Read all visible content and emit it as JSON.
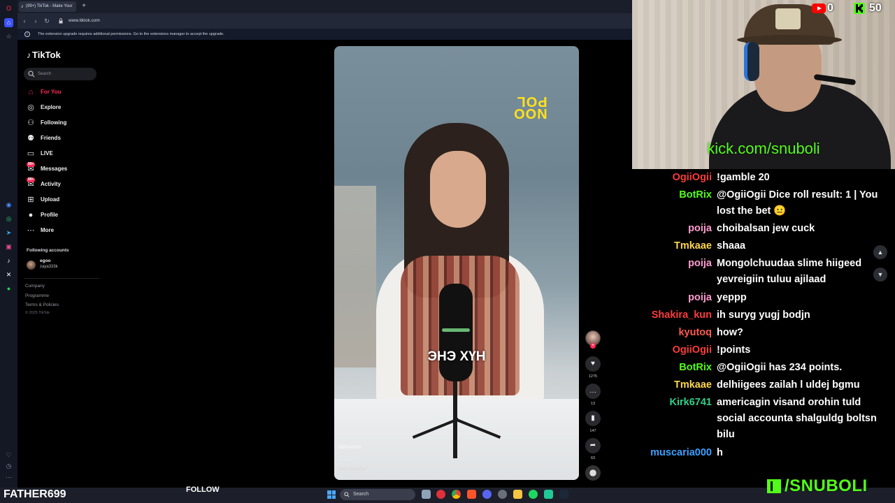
{
  "browser": {
    "tab_title": "(99+) TikTok - Make Your",
    "url": "www.tiktok.com",
    "notice": "The extension upgrade requires additional permissions. Go to the extensions manager to accept the upgrade."
  },
  "tiktok": {
    "logo": "TikTok",
    "search_placeholder": "Search",
    "nav": [
      {
        "label": "For You",
        "icon": "home-icon",
        "active": true
      },
      {
        "label": "Explore",
        "icon": "compass-icon"
      },
      {
        "label": "Following",
        "icon": "following-icon"
      },
      {
        "label": "Friends",
        "icon": "friends-icon"
      },
      {
        "label": "LIVE",
        "icon": "live-icon"
      },
      {
        "label": "Messages",
        "icon": "messages-icon",
        "badge": "99+"
      },
      {
        "label": "Activity",
        "icon": "activity-icon",
        "badge": "99+"
      },
      {
        "label": "Upload",
        "icon": "upload-icon"
      },
      {
        "label": "Profile",
        "icon": "profile-icon"
      },
      {
        "label": "More",
        "icon": "more-icon"
      }
    ],
    "following_accounts_title": "Following accounts",
    "account": {
      "name": "egoo",
      "handle": "zaya333k"
    },
    "footer": [
      "Company",
      "Programme",
      "Terms & Policies"
    ],
    "copyright": "© 2025 TikTok"
  },
  "video": {
    "brand": "NOO\nPOL",
    "caption": "ЭНЭ ХҮН",
    "author": "dahuvan0",
    "description": "Б.Ринчен",
    "see_translation": "See translation",
    "likes": "1275",
    "comments": "13",
    "saves": "147",
    "shares": "63"
  },
  "stream": {
    "youtube_count": "0",
    "kick_count": "50",
    "kick_url": "kick.com/snuboli",
    "streamer_name": "FATHER699",
    "follow_label": "FOLLOW",
    "kick_handle": "/SNUBOLI",
    "colors": {
      "kick_green": "#53fc18",
      "youtube_red": "#ff0000"
    }
  },
  "chat": [
    {
      "user": "OgiiOgii",
      "color": "#ff3b3b",
      "text": "!gamble 20"
    },
    {
      "user": "BotRix",
      "color": "#53fc18",
      "text": "@OgiiOgii Dice roll result: 1 | You lost the bet 😐"
    },
    {
      "user": "poija",
      "color": "#ff9cd0",
      "text": "choibalsan jew cuck"
    },
    {
      "user": "Tmkaae",
      "color": "#ffd84a",
      "text": "shaaa"
    },
    {
      "user": "poija",
      "color": "#ff9cd0",
      "text": "Mongolchuudaa slime hiigeed yevreigiin tuluu ajilaad"
    },
    {
      "user": "poija",
      "color": "#ff9cd0",
      "text": "yeppp"
    },
    {
      "user": "Shakira_kun",
      "color": "#ff3b3b",
      "text": "ih suryg yugj bodjn"
    },
    {
      "user": "kyutoq",
      "color": "#ff5a4e",
      "text": "how?"
    },
    {
      "user": "OgiiOgii",
      "color": "#ff3b3b",
      "text": "!points"
    },
    {
      "user": "BotRix",
      "color": "#53fc18",
      "text": "@OgiiOgii has 234 points."
    },
    {
      "user": "Tmkaae",
      "color": "#ffd84a",
      "text": "delhiigees zailah l uldej bgmu"
    },
    {
      "user": "Kirk6741",
      "color": "#2fd08a",
      "text": "americagin visand orohin tuld social accounta shalguldg boltsn bilu"
    },
    {
      "user": "muscaria000",
      "color": "#3ba0ff",
      "text": "h"
    }
  ],
  "taskbar": {
    "search_placeholder": "Search"
  }
}
